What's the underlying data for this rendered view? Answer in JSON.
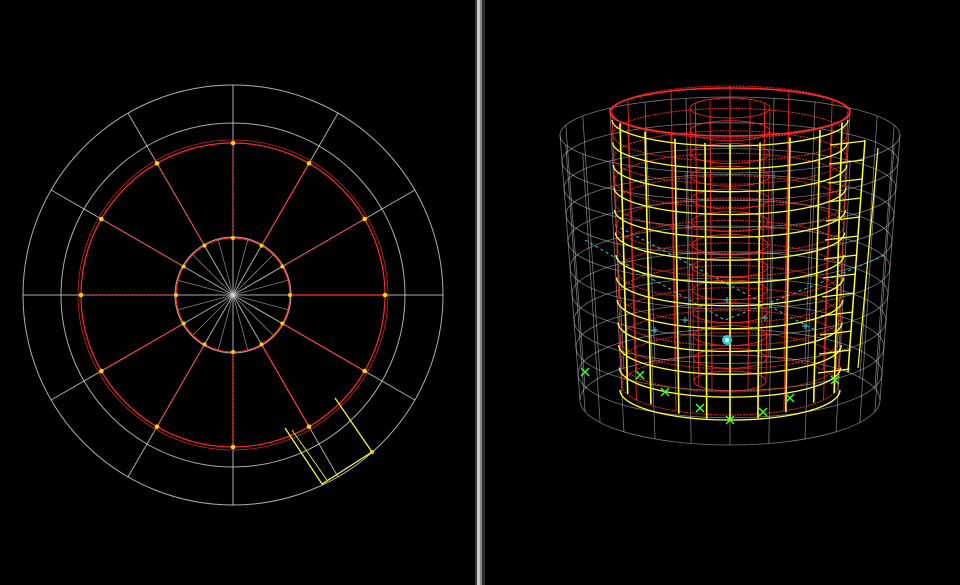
{
  "app": {
    "views": [
      {
        "id": "plan-view",
        "kind": "plan"
      },
      {
        "id": "3d-view",
        "kind": "3d"
      }
    ]
  },
  "colors": {
    "background": "#000000",
    "grid": "#d9d9d9",
    "frame": "#ff2a2a",
    "beam": "#ffff33",
    "joint": "#ffd400",
    "support": "#33ff33",
    "axis": "#33ccdd"
  },
  "icons": [
    "joint-marker",
    "support-marker",
    "origin-marker"
  ]
}
